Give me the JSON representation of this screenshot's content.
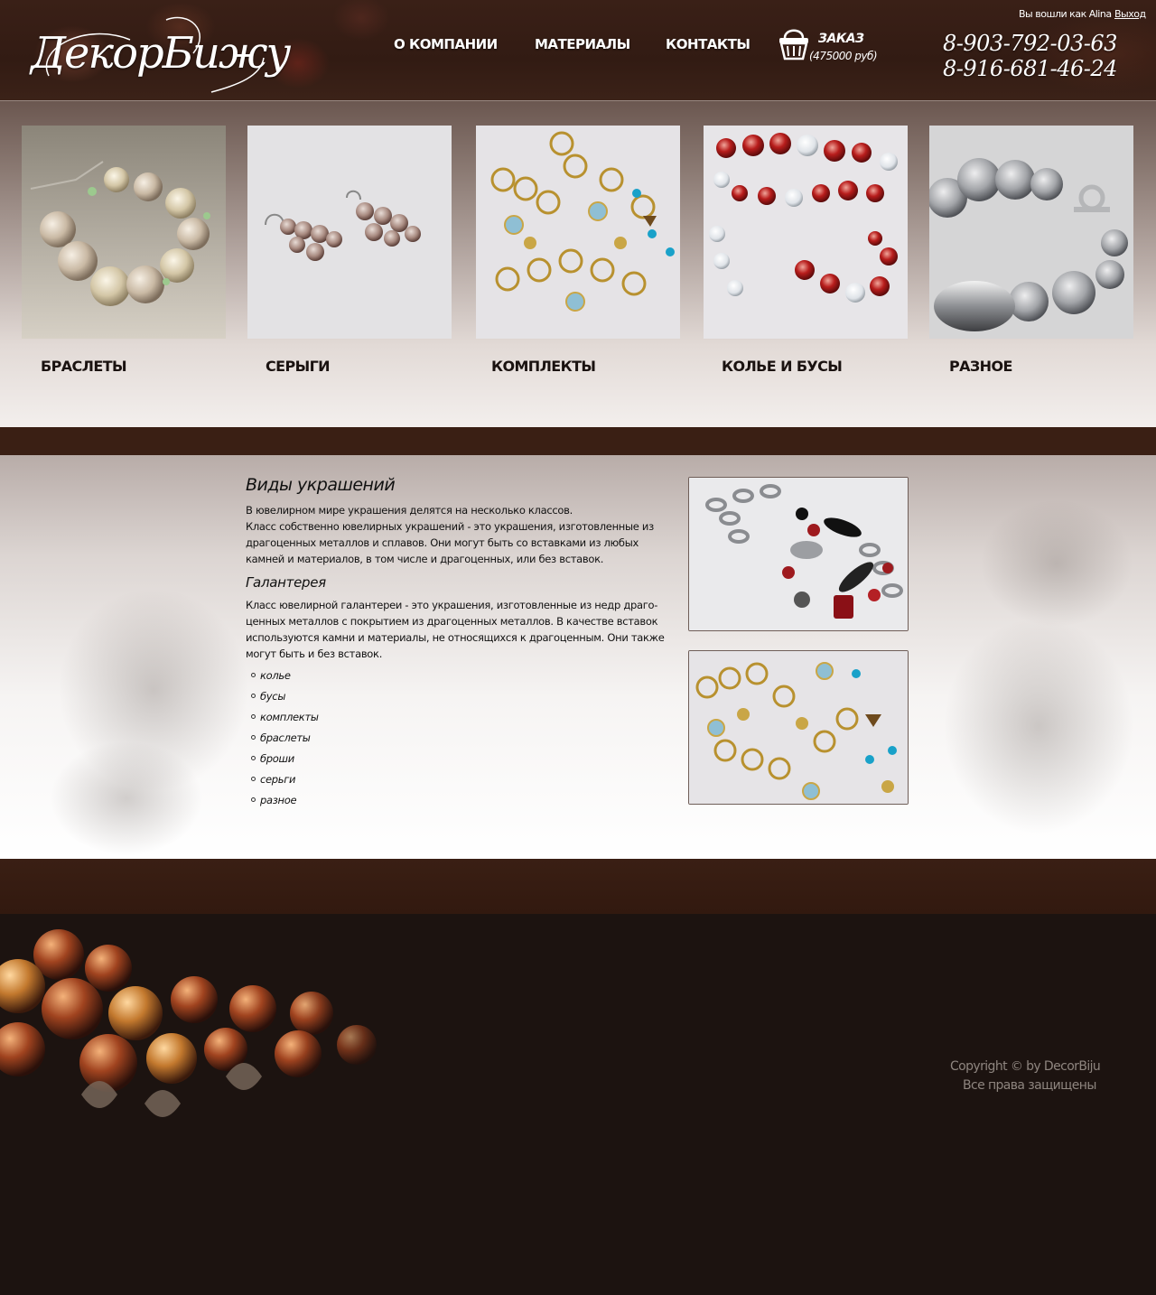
{
  "header": {
    "logo_text": "ДекорБижу",
    "nav": [
      {
        "label": "О КОМПАНИИ"
      },
      {
        "label": "МАТЕРИАЛЫ"
      },
      {
        "label": "КОНТАКТЫ"
      }
    ],
    "cart": {
      "icon": "basket-icon",
      "title": "ЗАКАЗ",
      "sum": "(475000 руб)"
    },
    "login": {
      "text": "Вы вошли как Alina",
      "logout": "Выход"
    },
    "phones": [
      "8-903-792-03-63",
      "8-916-681-46-24"
    ]
  },
  "categories": [
    {
      "label": "БРАСЛЕТЫ",
      "image": "pearl-bracelet-photo"
    },
    {
      "label": "СЕРЫГИ",
      "image": "beaded-earrings-photo"
    },
    {
      "label": "КОМПЛЕКТЫ",
      "image": "gold-chain-set-photo"
    },
    {
      "label": "КОЛЬЕ И БУСЫ",
      "image": "red-bead-necklace-photo"
    },
    {
      "label": "РАЗНОЕ",
      "image": "grey-agate-bracelet-photo"
    }
  ],
  "content": {
    "title": "Виды украшений",
    "intro": "В ювелирном мире украшения делятся на несколько классов.",
    "para1": "Класс собственно ювелирных украшений - это украшения, изготовленные из драгоценных металлов и сплавов. Они могут быть со вставками из любых камней и материалов, в том числе  и драгоценных, или без вставок.",
    "subtitle": "Галантерея",
    "para2": "Класс ювелирной галантереи - это украшения, изготовленные из недр драго-ценных металлов с покрытием из драгоценных металлов. В качестве вставок используются камни и материалы, не относящихся к драгоценным. Они также могут быть и без вставок.",
    "list": [
      "колье",
      "бусы",
      "комплекты",
      "браслеты",
      "броши",
      "серьги",
      "разное"
    ],
    "photos": [
      "silver-chain-necklace-photo",
      "gold-chain-set-photo"
    ]
  },
  "footer": {
    "copyright": "Copyright © by DecorBiju",
    "rights": "Все права защищены"
  },
  "colors": {
    "brown_dark": "#3a1f14",
    "footer_bg": "#1c1310",
    "footer_text": "#8e857f"
  }
}
